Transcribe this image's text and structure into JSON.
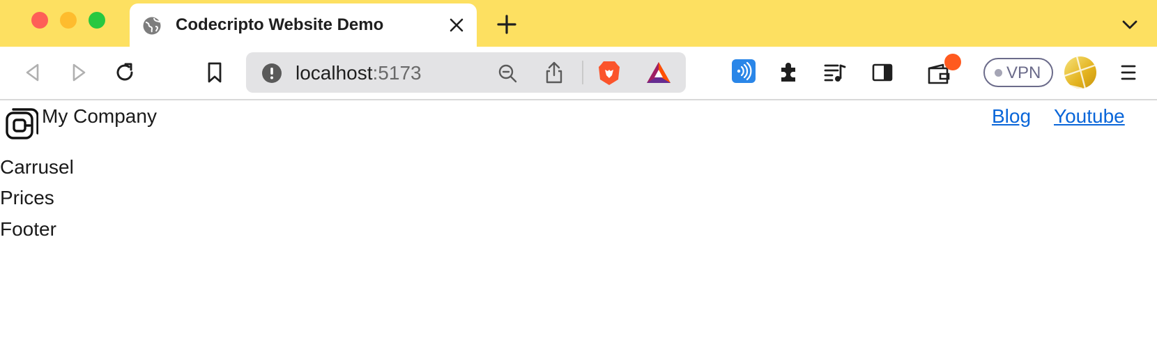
{
  "browser": {
    "tab": {
      "title": "Codecripto Website Demo",
      "icon": "globe-icon"
    },
    "address_bar": {
      "host": "localhost",
      "port": ":5173"
    },
    "vpn": {
      "label": "VPN"
    },
    "theme_color": "#fde061",
    "notification_color": "#ff5a1f"
  },
  "page": {
    "header": {
      "logo_icon": "at-sign-logo-icon",
      "company_name": "My Company",
      "nav_links": [
        "Blog",
        "Youtube"
      ],
      "link_color": "#0a66d9"
    },
    "sections": [
      "Carrusel",
      "Prices",
      "Footer"
    ]
  }
}
